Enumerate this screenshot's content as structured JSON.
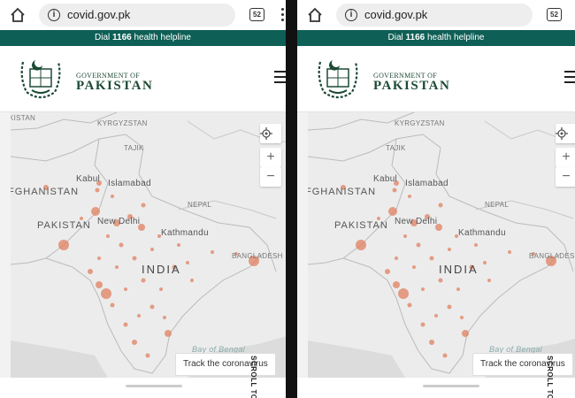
{
  "browser": {
    "url": "covid.gov.pk",
    "tab_count": "52",
    "icons": [
      "home-icon",
      "info-icon",
      "tab-switcher-icon",
      "menu-dots-icon"
    ]
  },
  "helpline": {
    "prefix": "Dial ",
    "number": "1166",
    "suffix": " health helpline"
  },
  "header": {
    "gov_line1": "GOVERNMENT OF",
    "gov_line2": "PAKISTAN",
    "brand_color": "#0e5f56",
    "menu_icon": "hamburger-icon"
  },
  "map": {
    "labels": {
      "kyrgyzstan": "KYRGYZSTAN",
      "tajik": "TAJIK",
      "kistan": "KISTAN",
      "afghanistan": "FGHANISTAN",
      "kabul": "Kabul",
      "islamabad": "Islamabad",
      "pakistan": "PAKISTAN",
      "new_delhi": "New Delhi",
      "nepal": "NEPAL",
      "kathmandu": "Kathmandu",
      "india": "INDIA",
      "bangladesh": "BANGLADESH",
      "bay": "Bay of Bengal"
    },
    "controls": {
      "locate_icon": "crosshair-icon",
      "zoom_in": "+",
      "zoom_out": "−"
    },
    "dot_color": "#e08060"
  },
  "track_button": "Track the coronavirus",
  "scroll_top": "SCROLL TOP"
}
